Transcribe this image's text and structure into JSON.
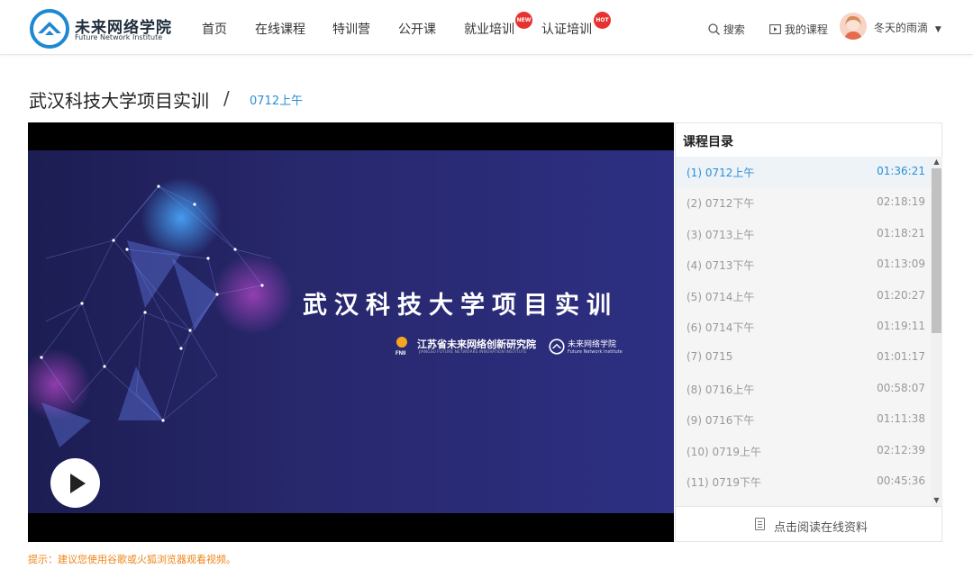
{
  "header": {
    "logo_cn": "未来网络学院",
    "logo_en": "Future Network Institute",
    "nav": [
      {
        "label": "首页"
      },
      {
        "label": "在线课程"
      },
      {
        "label": "特训营"
      },
      {
        "label": "公开课"
      },
      {
        "label": "就业培训",
        "badge": "NEW"
      },
      {
        "label": "认证培训",
        "badge": "HOT"
      }
    ],
    "search_label": "搜索",
    "my_courses_label": "我的课程",
    "username": "冬天的雨滴",
    "accent_color": "#2a8fd6",
    "badge_color": "#e8322f"
  },
  "page": {
    "title": "武汉科技大学项目实训",
    "separator": "/",
    "current_lesson": "0712上午"
  },
  "player": {
    "slide_title": "武汉科技大学项目实训",
    "org_name": "江苏省未来网络创新研究院",
    "org_name_en": "JIANGSU FUTURE NETWORKS INNOVATION INSTITUTE",
    "org_abbr": "FNII",
    "institute_name": "未来网络学院",
    "institute_name_en": "Future Network Institute",
    "play_icon": "play-icon"
  },
  "catalog": {
    "title": "课程目录",
    "items": [
      {
        "label": "(1)  0712上午",
        "duration": "01:36:21",
        "active": true
      },
      {
        "label": "(2)  0712下午",
        "duration": "02:18:19"
      },
      {
        "label": "(3)  0713上午",
        "duration": "01:18:21"
      },
      {
        "label": "(4)  0713下午",
        "duration": "01:13:09"
      },
      {
        "label": "(5)  0714上午",
        "duration": "01:20:27"
      },
      {
        "label": "(6)  0714下午",
        "duration": "01:19:11"
      },
      {
        "label": "(7)  0715",
        "duration": "01:01:17"
      },
      {
        "label": "(8)  0716上午",
        "duration": "00:58:07"
      },
      {
        "label": "(9)  0716下午",
        "duration": "01:11:38"
      },
      {
        "label": "(10)  0719上午",
        "duration": "02:12:39"
      },
      {
        "label": "(11)  0719下午",
        "duration": "00:45:36"
      }
    ],
    "read_link": "点击阅读在线资料"
  },
  "tip": "提示：建议您使用谷歌或火狐浏览器观看视频。"
}
